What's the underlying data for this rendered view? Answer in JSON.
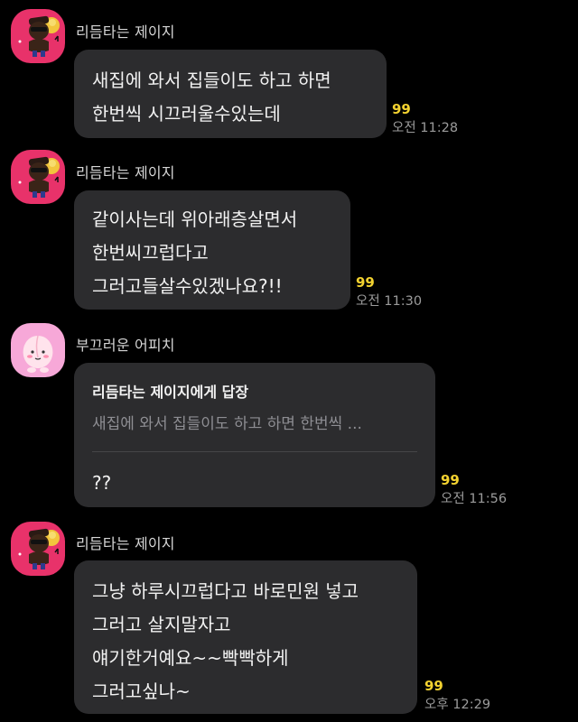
{
  "messages": [
    {
      "sender": "리듬타는 제이지",
      "lines": [
        "새집에 와서 집들이도 하고 하면",
        "한번씩 시끄러울수있는데"
      ],
      "unread_count": "99",
      "time": "오전 11:28"
    },
    {
      "sender": "리듬타는 제이지",
      "lines": [
        "같이사는데 위아래층살면서",
        "한번씨끄럽다고",
        "그러고들살수있겠나요?!!"
      ],
      "unread_count": "99",
      "time": "오전 11:30"
    },
    {
      "sender": "부끄러운 어피치",
      "reply_title": "리듬타는 제이지에게 답장",
      "reply_quote": "새집에 와서 집들이도 하고 하면 한번씩 ...",
      "lines": [
        "??"
      ],
      "unread_count": "99",
      "time": "오전 11:56"
    },
    {
      "sender": "리듬타는 제이지",
      "lines": [
        "그냥 하루시끄럽다고 바로민원 넣고",
        "그러고 살지말자고",
        "얘기한거예요~~빡빡하게",
        "그러고싶나~"
      ],
      "unread_count": "99",
      "time": "오후 12:29"
    }
  ],
  "colors": {
    "background": "#000000",
    "bubble": "#2c2c2e",
    "unread": "#f3d230",
    "jayg_avatar_bg": "#e8326a",
    "apeach_avatar_bg": "#f7a8d8"
  },
  "icons": {
    "jayg_avatar": "jay-g-character-icon",
    "apeach_avatar": "apeach-character-icon"
  }
}
